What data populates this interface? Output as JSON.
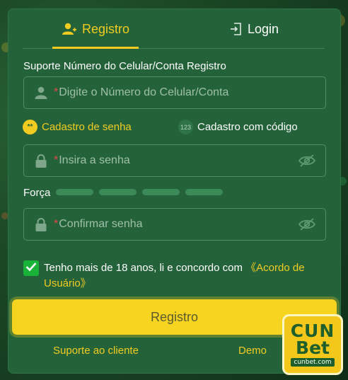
{
  "tabs": {
    "register_label": "Registro",
    "login_label": "Login"
  },
  "account": {
    "label": "Suporte Número do Celular/Conta Registro",
    "placeholder": "Digite o Número do Celular/Conta"
  },
  "register_options": {
    "password_mode_label": "Cadastro de senha",
    "password_mode_icon": "**",
    "code_mode_label": "Cadastro com código",
    "code_mode_icon": "123"
  },
  "password": {
    "placeholder": "Insira a senha"
  },
  "strength": {
    "label": "Força",
    "level": 0,
    "segments": 4
  },
  "confirm": {
    "placeholder": "Confirmar senha"
  },
  "required_mark": "*",
  "agreement": {
    "text": "Tenho mais de 18 anos, li e concordo com ",
    "link": "《Acordo de Usuário》",
    "checked": true
  },
  "submit_label": "Registro",
  "footer": {
    "support": "Suporte ao cliente",
    "demo": "Demo"
  },
  "logo": {
    "line1": "CUN",
    "line2": "Bet",
    "line3": "cunbet.com"
  },
  "colors": {
    "panel": "#24633a",
    "accent": "#f2cb21",
    "checkbox": "#19b33a"
  }
}
